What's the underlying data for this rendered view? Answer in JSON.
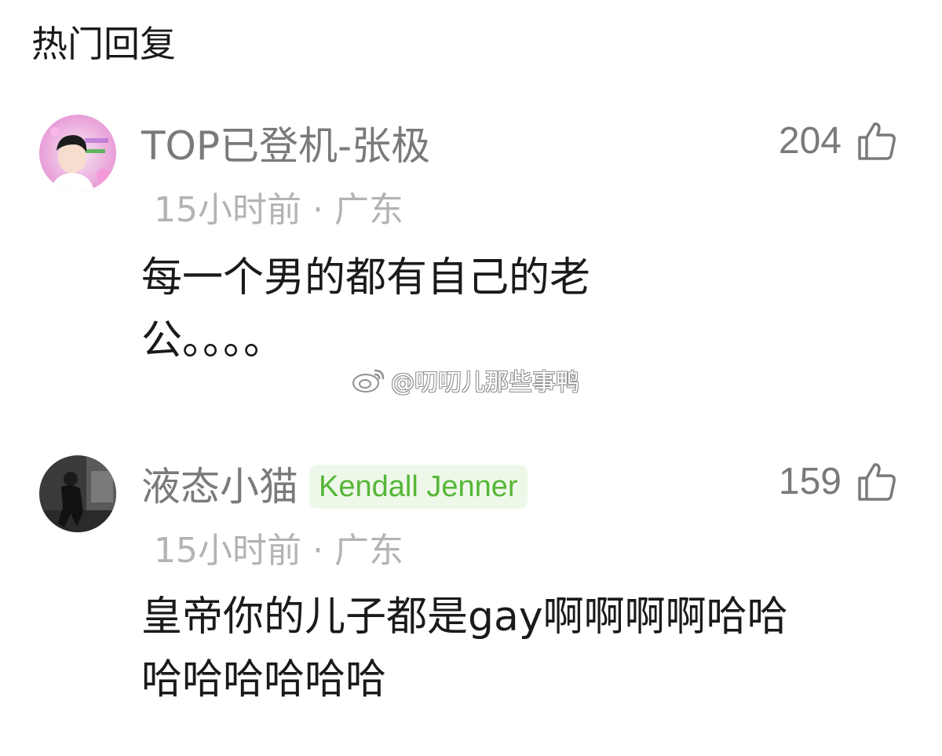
{
  "section": {
    "title": "热门回复"
  },
  "comments": [
    {
      "username": "TOP已登机-张极",
      "badge": "",
      "meta": "15小时前 · 广东",
      "likes": "204",
      "lines": [
        "每一个男的都有自己的老",
        "公。。。。"
      ],
      "avatar_icon": "portrait-avatar-icon"
    },
    {
      "username": "液态小猫",
      "badge": "Kendall Jenner",
      "meta": "15小时前 · 广东",
      "likes": "159",
      "lines": [
        "皇帝你的儿子都是gay啊啊啊啊哈哈",
        "哈哈哈哈哈哈"
      ],
      "avatar_icon": "dark-photo-avatar-icon"
    }
  ],
  "watermark": {
    "text": "@叨叨儿那些事鸭",
    "icon": "weibo-logo-icon"
  },
  "colors": {
    "badge_text": "#55b637",
    "badge_bg": "#eef8e9",
    "muted": "#7a7a7a",
    "meta": "#b3b3b3"
  }
}
